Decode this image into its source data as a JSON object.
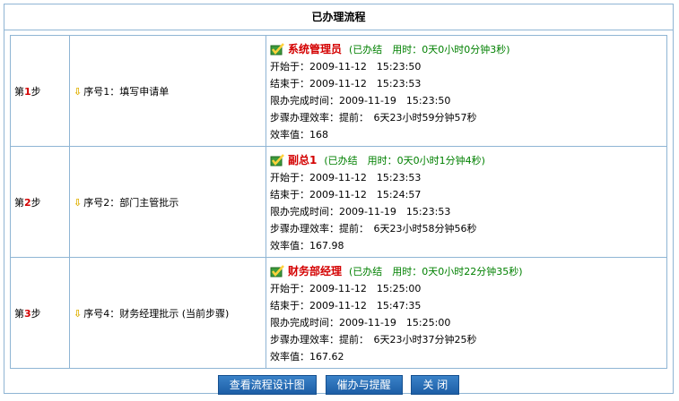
{
  "page": {
    "title": "已办理流程"
  },
  "steps": [
    {
      "step_prefix": "第",
      "step_num": "1",
      "step_suffix": "步",
      "node": "序号1：填写申请单",
      "handler": "系统管理员",
      "status": "(已办结　用时：0天0小时0分钟3秒)",
      "start": "开始于：2009-11-12　15:23:50",
      "end": "结束于：2009-11-12　15:23:53",
      "deadline": "限办完成时间：2009-11-19　15:23:50",
      "efficiency": "步骤办理效率：提前：　6天23小时59分钟57秒",
      "score": "效率值：168"
    },
    {
      "step_prefix": "第",
      "step_num": "2",
      "step_suffix": "步",
      "node": "序号2：部门主管批示",
      "handler": "副总1",
      "status": "(已办结　用时：0天0小时1分钟4秒)",
      "start": "开始于：2009-11-12　15:23:53",
      "end": "结束于：2009-11-12　15:24:57",
      "deadline": "限办完成时间：2009-11-19　15:23:53",
      "efficiency": "步骤办理效率：提前：　6天23小时58分钟56秒",
      "score": "效率值：167.98"
    },
    {
      "step_prefix": "第",
      "step_num": "3",
      "step_suffix": "步",
      "node": "序号4：财务经理批示 (当前步骤)",
      "handler": "财务部经理",
      "status": "(已办结　用时：0天0小时22分钟35秒)",
      "start": "开始于：2009-11-12　15:25:00",
      "end": "结束于：2009-11-12　15:47:35",
      "deadline": "限办完成时间：2009-11-19　15:25:00",
      "efficiency": "步骤办理效率：提前：　6天23小时37分钟25秒",
      "score": "效率值：167.62"
    }
  ],
  "icons": {
    "checkmark": "checkmark-icon",
    "arrow": "down-arrow-icon"
  },
  "buttons": {
    "view_design": "查看流程设计图",
    "remind": "催办与提醒",
    "close": "关 闭"
  },
  "colors": {
    "border": "#8fb5d4",
    "handler": "#d40000",
    "status": "#008000",
    "button": "#2a6fb8"
  }
}
